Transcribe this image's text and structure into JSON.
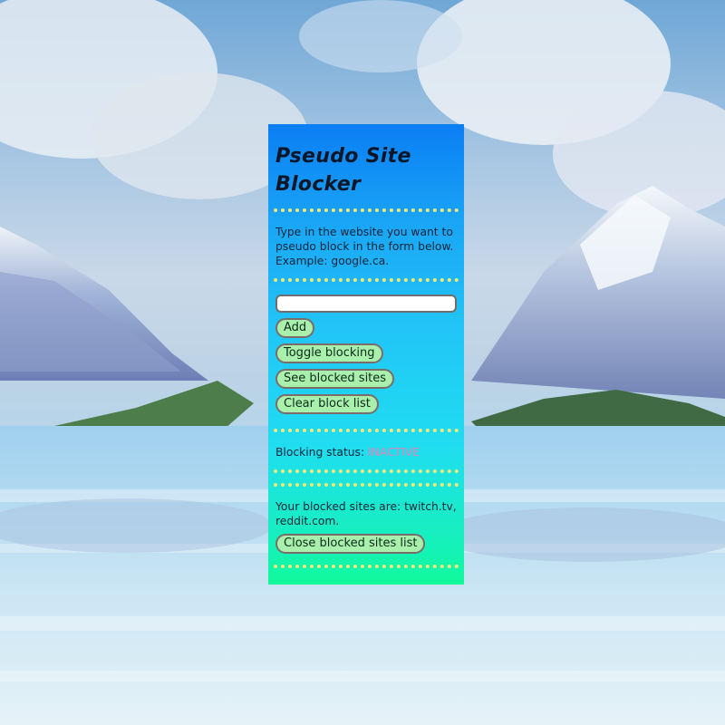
{
  "panel": {
    "title": "Pseudo Site Blocker",
    "intro": "Type in the website you want to pseudo block in the form below. Example: google.ca.",
    "input_value": "",
    "buttons": {
      "add": "Add",
      "toggle": "Toggle blocking",
      "see": "See blocked sites",
      "clear": "Clear block list",
      "close": "Close blocked sites list"
    },
    "status_label": "Blocking status:",
    "status_value": "INACTIVE",
    "sites_text": "Your blocked sites are: twitch.tv, reddit.com."
  },
  "colors": {
    "panel_top": "#0a7ef4",
    "panel_bottom": "#10f99a",
    "button_fill": "#a9f0ac",
    "divider": "#f2e97a",
    "status_inactive": "#f07db0"
  }
}
